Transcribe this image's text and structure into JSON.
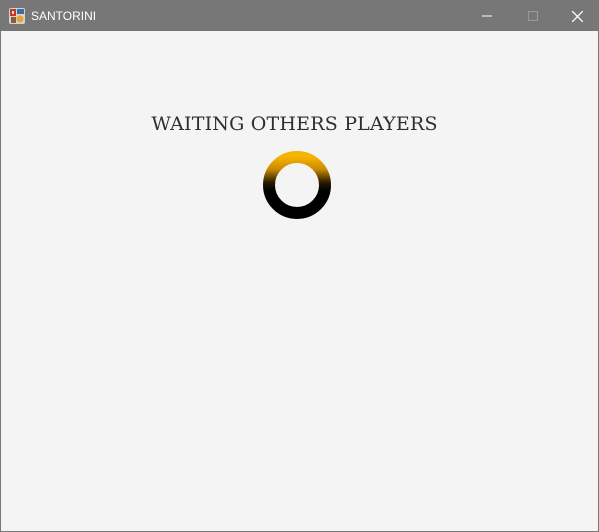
{
  "window": {
    "title": "SANTORINI",
    "app_icon": "santorini-app-icon",
    "controls": {
      "minimize_icon": "minimize-icon",
      "maximize_icon": "maximize-icon",
      "close_icon": "close-icon"
    }
  },
  "main": {
    "status_text": "WAITING OTHERS PLAYERS",
    "spinner_icon": "loading-spinner-icon"
  },
  "colors": {
    "titlebar": "#777777",
    "background": "#f4f4f4",
    "spinner_accent": "#f5b400",
    "spinner_track": "#000000",
    "text": "#2e2e2e"
  }
}
